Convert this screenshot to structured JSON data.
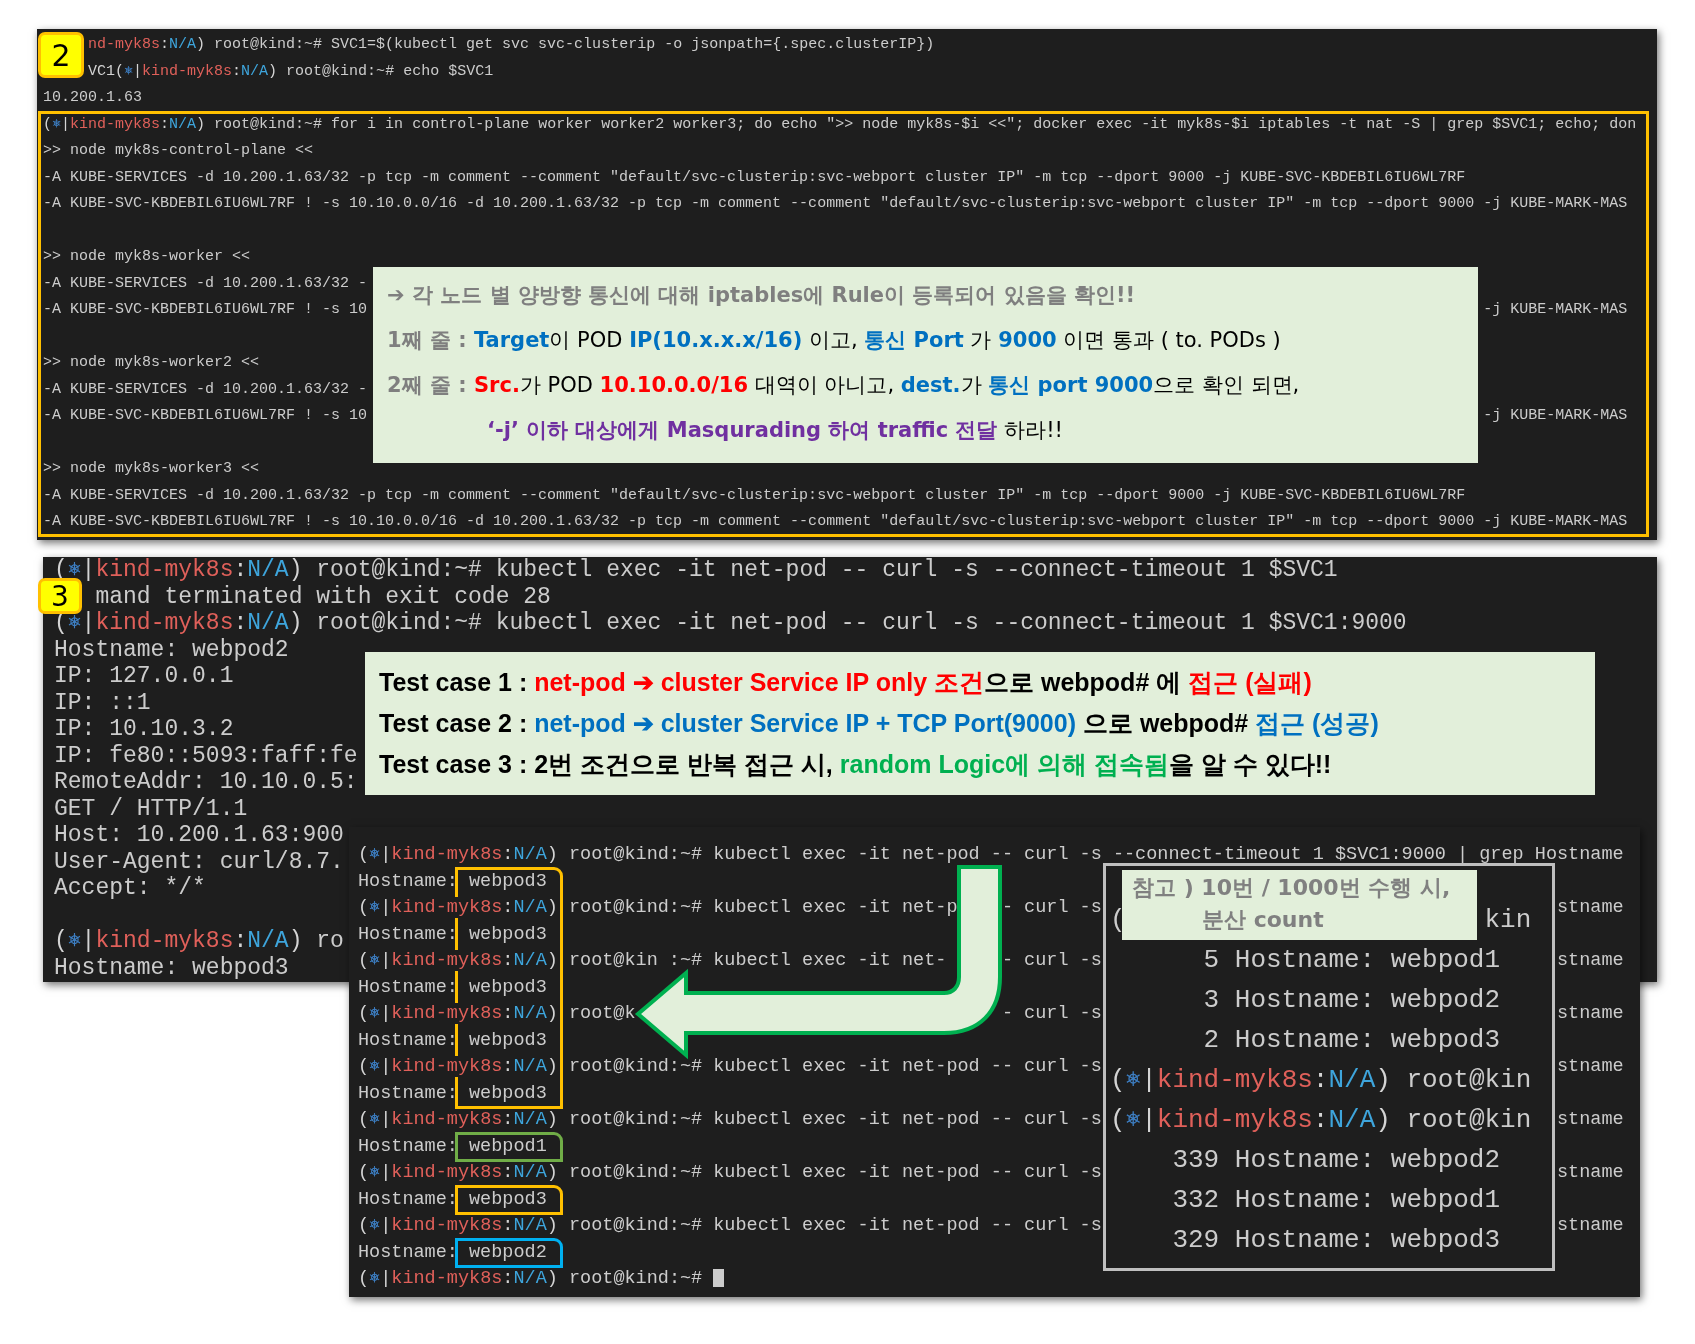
{
  "step_2": {
    "badge": "2",
    "lines": [
      {
        "kind": "prompt",
        "prompt": {
          "context": "nd-myk8s",
          "colon": ":",
          "namespace": "N/A",
          "close": ")"
        },
        "command": "root@kind:~# SVC1=$(kubectl get svc svc-clusterip -o jsonpath={.spec.clusterIP})"
      },
      {
        "kind": "prompt",
        "prompt": {
          "lead": "VC1",
          "open": "(",
          "icon": "⎈",
          "bar": "|",
          "context": "kind-myk8s",
          "colon": ":",
          "namespace": "N/A",
          "close": ")"
        },
        "command": "root@kind:~# echo $SVC1"
      },
      {
        "kind": "output",
        "text": "10.200.1.63"
      },
      {
        "kind": "prompt",
        "prompt": {
          "open": "(",
          "icon": "⎈",
          "bar": "|",
          "context": "kind-myk8s",
          "colon": ":",
          "namespace": "N/A",
          "close": ")"
        },
        "command": "root@kind:~# for i in control-plane worker worker2 worker3; do echo \">> node myk8s-$i <<\"; docker exec -it myk8s-$i iptables -t nat -S | grep $SVC1; echo; don"
      },
      {
        "kind": "output",
        "text": ">> node myk8s-control-plane <<"
      },
      {
        "kind": "output",
        "text": "-A KUBE-SERVICES -d 10.200.1.63/32 -p tcp -m comment --comment \"default/svc-clusterip:svc-webport cluster IP\" -m tcp --dport 9000 -j KUBE-SVC-KBDEBIL6IU6WL7RF"
      },
      {
        "kind": "output",
        "text": "-A KUBE-SVC-KBDEBIL6IU6WL7RF ! -s 10.10.0.0/16 -d 10.200.1.63/32 -p tcp -m comment --comment \"default/svc-clusterip:svc-webport cluster IP\" -m tcp --dport 9000 -j KUBE-MARK-MAS"
      },
      {
        "kind": "blank"
      },
      {
        "kind": "output",
        "text": ">> node myk8s-worker <<"
      },
      {
        "kind": "split",
        "left": "-A KUBE-SERVICES -d 10.200.1.63/32 -"
      },
      {
        "kind": "split",
        "left": "-A KUBE-SVC-KBDEBIL6IU6WL7RF ! -s 10",
        "right": "-j KUBE-MARK-MAS"
      },
      {
        "kind": "blank"
      },
      {
        "kind": "output",
        "text": ">> node myk8s-worker2 <<"
      },
      {
        "kind": "split",
        "left": "-A KUBE-SERVICES -d 10.200.1.63/32 -"
      },
      {
        "kind": "split",
        "left": "-A KUBE-SVC-KBDEBIL6IU6WL7RF ! -s 10",
        "right": "-j KUBE-MARK-MAS"
      },
      {
        "kind": "blank"
      },
      {
        "kind": "output",
        "text": ">> node myk8s-worker3 <<"
      },
      {
        "kind": "output",
        "text": "-A KUBE-SERVICES -d 10.200.1.63/32 -p tcp -m comment --comment \"default/svc-clusterip:svc-webport cluster IP\" -m tcp --dport 9000 -j KUBE-SVC-KBDEBIL6IU6WL7RF"
      },
      {
        "kind": "output",
        "text": "-A KUBE-SVC-KBDEBIL6IU6WL7RF ! -s 10.10.0.0/16 -d 10.200.1.63/32 -p tcp -m comment --comment \"default/svc-clusterip:svc-webport cluster IP\" -m tcp --dport 9000 -j KUBE-MARK-MAS"
      }
    ],
    "callout": [
      [
        {
          "text": "➔ 각 노드 별 양방향 통신에 대해 iptables에 Rule이 등록되어 있음을 확인!!",
          "color": "#7f7f7f"
        }
      ],
      [
        {
          "text": "1째 줄 : ",
          "color": "#7f7f7f"
        },
        {
          "text": "Target",
          "color": "#0070c0"
        },
        {
          "text": "이 POD "
        },
        {
          "text": "IP(10.x.x.x/16)",
          "color": "#0070c0"
        },
        {
          "text": " 이고, "
        },
        {
          "text": "통신 Port",
          "color": "#0070c0"
        },
        {
          "text": " 가 "
        },
        {
          "text": "9000",
          "color": "#0070c0"
        },
        {
          "text": " 이면 통과 ( to. PODs )"
        }
      ],
      [
        {
          "text": "2째 줄 : ",
          "color": "#7f7f7f"
        },
        {
          "text": "Src.",
          "color": "#ff0000"
        },
        {
          "text": "가 POD "
        },
        {
          "text": "10.10.0.0/16",
          "color": "#ff0000"
        },
        {
          "text": " 대역이 아니고, "
        },
        {
          "text": "dest.",
          "color": "#0070c0"
        },
        {
          "text": "가 "
        },
        {
          "text": "통신 port 9000",
          "color": "#0070c0"
        },
        {
          "text": "으로 확인 되면,"
        }
      ],
      [
        {
          "text": "‘-j’ 이하 대상에게 Masqurading 하여 traffic 전달",
          "color": "#7030a0"
        },
        {
          "text": " 하라!!"
        }
      ]
    ]
  },
  "step_3": {
    "badge": "3",
    "lines": [
      {
        "kind": "prompt",
        "prompt": {
          "open": "(",
          "icon": "⎈",
          "bar": "|",
          "context": "kind-myk8s",
          "colon": ":",
          "namespace": "N/A",
          "close": ")"
        },
        "command": "root@kind:~# kubectl exec -it net-pod -- curl -s --connect-timeout 1 $SVC1"
      },
      {
        "kind": "output",
        "text": "mand terminated with exit code 28"
      },
      {
        "kind": "prompt",
        "prompt": {
          "open": "(",
          "icon": "⎈",
          "bar": "|",
          "context": "kind-myk8s",
          "colon": ":",
          "namespace": "N/A",
          "close": ")"
        },
        "command": "root@kind:~# kubectl exec -it net-pod -- curl -s --connect-timeout 1 $SVC1:9000"
      },
      {
        "kind": "output",
        "text": "Hostname: webpod2"
      },
      {
        "kind": "output",
        "text": "IP: 127.0.0.1"
      },
      {
        "kind": "output",
        "text": "IP: ::1"
      },
      {
        "kind": "output",
        "text": "IP: 10.10.3.2"
      },
      {
        "kind": "output",
        "text": "IP: fe80::5093:faff:fe"
      },
      {
        "kind": "output",
        "text": "RemoteAddr: 10.10.0.5:"
      },
      {
        "kind": "output",
        "text": "GET / HTTP/1.1"
      },
      {
        "kind": "output",
        "text": "Host: 10.200.1.63:900"
      },
      {
        "kind": "output",
        "text": "User-Agent: curl/8.7."
      },
      {
        "kind": "output",
        "text": "Accept: */*"
      },
      {
        "kind": "blank"
      },
      {
        "kind": "prompt",
        "prompt": {
          "open": "(",
          "icon": "⎈",
          "bar": "|",
          "context": "kind-myk8s",
          "colon": ":",
          "namespace": "N/A",
          "close": ")"
        },
        "command": "ro"
      },
      {
        "kind": "output",
        "text": "Hostname: webpod3"
      }
    ],
    "callout": [
      [
        {
          "text": "Test case 1 : "
        },
        {
          "text": "net-pod ➔ cluster Service IP only 조건",
          "color": "#ff0000"
        },
        {
          "text": "으로 webpod# 에 "
        },
        {
          "text": "접근 (실패)",
          "color": "#ff0000"
        }
      ],
      [
        {
          "text": "Test case 2 : "
        },
        {
          "text": "net-pod ➔ cluster Service IP + TCP Port(9000)",
          "color": "#0070c0"
        },
        {
          "text": " 으로 webpod# "
        },
        {
          "text": "접근 (성공)",
          "color": "#0070c0"
        }
      ],
      [
        {
          "text": "Test case 3 : 2번 조건으로 반복 접근 시, "
        },
        {
          "text": "random Logic에 의해 접속됨",
          "color": "#00b050"
        },
        {
          "text": "을 알 수 있다!!"
        }
      ]
    ]
  },
  "repeat_terminal": {
    "groups": [
      {
        "color": "#ffc000",
        "entries": [
          {
            "prompt": {
              "open": "(",
              "icon": "⎈",
              "bar": "|",
              "context": "kind-myk8s",
              "colon": ":",
              "namespace": "N/A",
              "close": ")"
            },
            "command": [
              "root@kind:~# kubectl exec -it net-pod -- curl -s --connect-timeout 1 $SVC1:9000 | grep Hostname"
            ],
            "label": "Hostname:",
            "hostname": "webpod3"
          },
          {
            "prompt": {
              "open": "(",
              "icon": "⎈",
              "bar": "|",
              "context": "kind-myk8s",
              "colon": ":",
              "namespace": "N/A",
              "close": ")"
            },
            "command": [
              "root@kind:~# kubectl exec -it net-p",
              "- curl -s",
              "stname"
            ],
            "label": "Hostname:",
            "hostname": "webpod3"
          },
          {
            "prompt": {
              "open": "(",
              "icon": "⎈",
              "bar": "|",
              "context": "kind-myk8s",
              "colon": ":",
              "namespace": "N/A",
              "close": ")"
            },
            "command": [
              "root@kin",
              ":~# kubectl exec -it net-",
              "- curl -s",
              "stname"
            ],
            "label": "Hostname:",
            "hostname": "webpod3"
          },
          {
            "prompt": {
              "open": "(",
              "icon": "⎈",
              "bar": "|",
              "context": "kind-myk8s",
              "colon": ":",
              "namespace": "N/A",
              "close": ")"
            },
            "command": [
              "root@k",
              "- curl -s",
              "stname"
            ],
            "label": "Hostname:",
            "hostname": "webpod3"
          },
          {
            "prompt": {
              "open": "(",
              "icon": "⎈",
              "bar": "|",
              "context": "kind-myk8s",
              "colon": ":",
              "namespace": "N/A",
              "close": ")"
            },
            "command": [
              "root@kind:~# kubectl exec -it net-pod -- curl -s",
              "stname"
            ],
            "label": "Hostname:",
            "hostname": "webpod3"
          }
        ]
      },
      {
        "color": "#70ad47",
        "entries": [
          {
            "prompt": {
              "open": "(",
              "icon": "⎈",
              "bar": "|",
              "context": "kind-myk8s",
              "colon": ":",
              "namespace": "N/A",
              "close": ")"
            },
            "command": [
              "root@kind:~# kubectl exec -it net-pod -- curl -s",
              "stname"
            ],
            "label": "Hostname:",
            "hostname": "webpod1"
          }
        ]
      },
      {
        "color": "#ffc000",
        "entries": [
          {
            "prompt": {
              "open": "(",
              "icon": "⎈",
              "bar": "|",
              "context": "kind-myk8s",
              "colon": ":",
              "namespace": "N/A",
              "close": ")"
            },
            "command": [
              "root@kind:~# kubectl exec -it net-pod -- curl -s",
              "stname"
            ],
            "label": "Hostname:",
            "hostname": "webpod3"
          }
        ]
      },
      {
        "color": "#00b0f0",
        "entries": [
          {
            "prompt": {
              "open": "(",
              "icon": "⎈",
              "bar": "|",
              "context": "kind-myk8s",
              "colon": ":",
              "namespace": "N/A",
              "close": ")"
            },
            "command": [
              "root@kind:~# kubectl exec -it net-pod -- curl -s",
              "stname"
            ],
            "label": "Hostname:",
            "hostname": "webpod2"
          }
        ]
      }
    ],
    "final_prompt": {
      "prompt": {
        "open": "(",
        "icon": "⎈",
        "bar": "|",
        "context": "kind-myk8s",
        "colon": ":",
        "namespace": "N/A",
        "close": ")"
      },
      "command": "root@kind:~#"
    },
    "count_note": {
      "title": [
        "참고 ) 10번 / 1000번 수행 시,",
        "분산 count"
      ],
      "rows": [
        {
          "kind": "pieces",
          "pieces": [
            "(",
            "kin"
          ]
        },
        {
          "kind": "count",
          "count": "5",
          "text": "Hostname: webpod1"
        },
        {
          "kind": "count",
          "count": "3",
          "text": "Hostname: webpod2"
        },
        {
          "kind": "count",
          "count": "2",
          "text": "Hostname: webpod3"
        },
        {
          "kind": "prompt",
          "prompt": {
            "open": "(",
            "icon": "⎈",
            "bar": "|",
            "context": "kind-myk8s",
            "colon": ":",
            "namespace": "N/A",
            "close": ")"
          },
          "command": "root@kin"
        },
        {
          "kind": "prompt",
          "prompt": {
            "open": "(",
            "icon": "⎈",
            "bar": "|",
            "context": "kind-myk8s",
            "colon": ":",
            "namespace": "N/A",
            "close": ")"
          },
          "command": "root@kin"
        },
        {
          "kind": "count",
          "count": "339",
          "text": "Hostname: webpod2"
        },
        {
          "kind": "count",
          "count": "332",
          "text": "Hostname: webpod1"
        },
        {
          "kind": "count",
          "count": "329",
          "text": "Hostname: webpod3"
        }
      ]
    }
  }
}
